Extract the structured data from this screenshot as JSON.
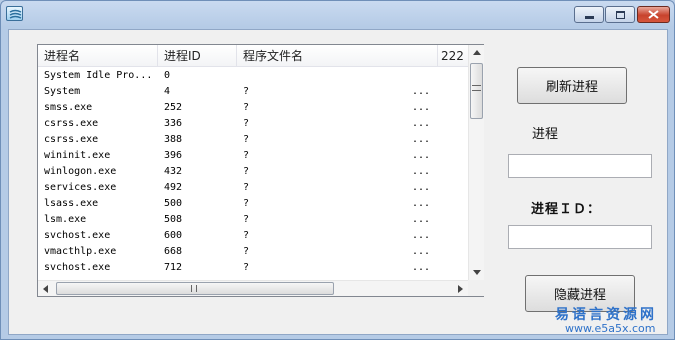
{
  "window": {
    "minimize_icon": "minimize-icon",
    "maximize_icon": "maximize-icon",
    "close_icon": "close-icon"
  },
  "list": {
    "columns": [
      "进程名",
      "进程ID",
      "程序文件名",
      "222"
    ],
    "rows": [
      {
        "name": "System Idle Pro...",
        "pid": "0",
        "path": "",
        "more": ""
      },
      {
        "name": "System",
        "pid": "4",
        "path": "?",
        "more": "..."
      },
      {
        "name": "smss.exe",
        "pid": "252",
        "path": "?",
        "more": "..."
      },
      {
        "name": "csrss.exe",
        "pid": "336",
        "path": "?",
        "more": "..."
      },
      {
        "name": "csrss.exe",
        "pid": "388",
        "path": "?",
        "more": "..."
      },
      {
        "name": "wininit.exe",
        "pid": "396",
        "path": "?",
        "more": "..."
      },
      {
        "name": "winlogon.exe",
        "pid": "432",
        "path": "?",
        "more": "..."
      },
      {
        "name": "services.exe",
        "pid": "492",
        "path": "?",
        "more": "..."
      },
      {
        "name": "lsass.exe",
        "pid": "500",
        "path": "?",
        "more": "..."
      },
      {
        "name": "lsm.exe",
        "pid": "508",
        "path": "?",
        "more": "..."
      },
      {
        "name": "svchost.exe",
        "pid": "600",
        "path": "?",
        "more": "..."
      },
      {
        "name": "vmacthlp.exe",
        "pid": "668",
        "path": "?",
        "more": "..."
      },
      {
        "name": "svchost.exe",
        "pid": "712",
        "path": "?",
        "more": "..."
      }
    ]
  },
  "controls": {
    "refresh_button": "刷新进程",
    "process_label": "进程",
    "process_value": "",
    "pid_label": "进程ＩＤ：",
    "pid_value": "",
    "hide_button": "隐藏进程"
  },
  "watermark": {
    "name": "易语言资源网",
    "url": "www.e5a5x.com"
  },
  "colors": {
    "title_bar": "#b5cbe6",
    "close_button": "#c8432d",
    "watermark": "#2f72c9"
  }
}
